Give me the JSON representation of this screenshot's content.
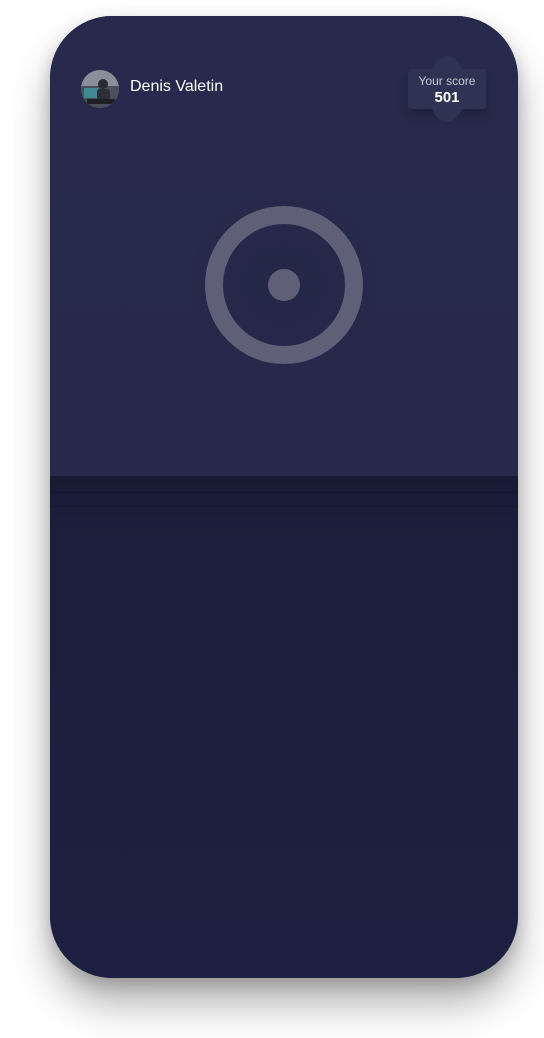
{
  "user": {
    "name": "Denis Valetin",
    "avatar_icon": "avatar-photo"
  },
  "score": {
    "label": "Your score",
    "value": "501"
  },
  "record": {
    "icon": "record-target-icon"
  },
  "colors": {
    "upper_bg": "#272a4c",
    "lower_bg": "#1c1f3b",
    "ring": "#5f6078",
    "text": "#ffffff"
  }
}
